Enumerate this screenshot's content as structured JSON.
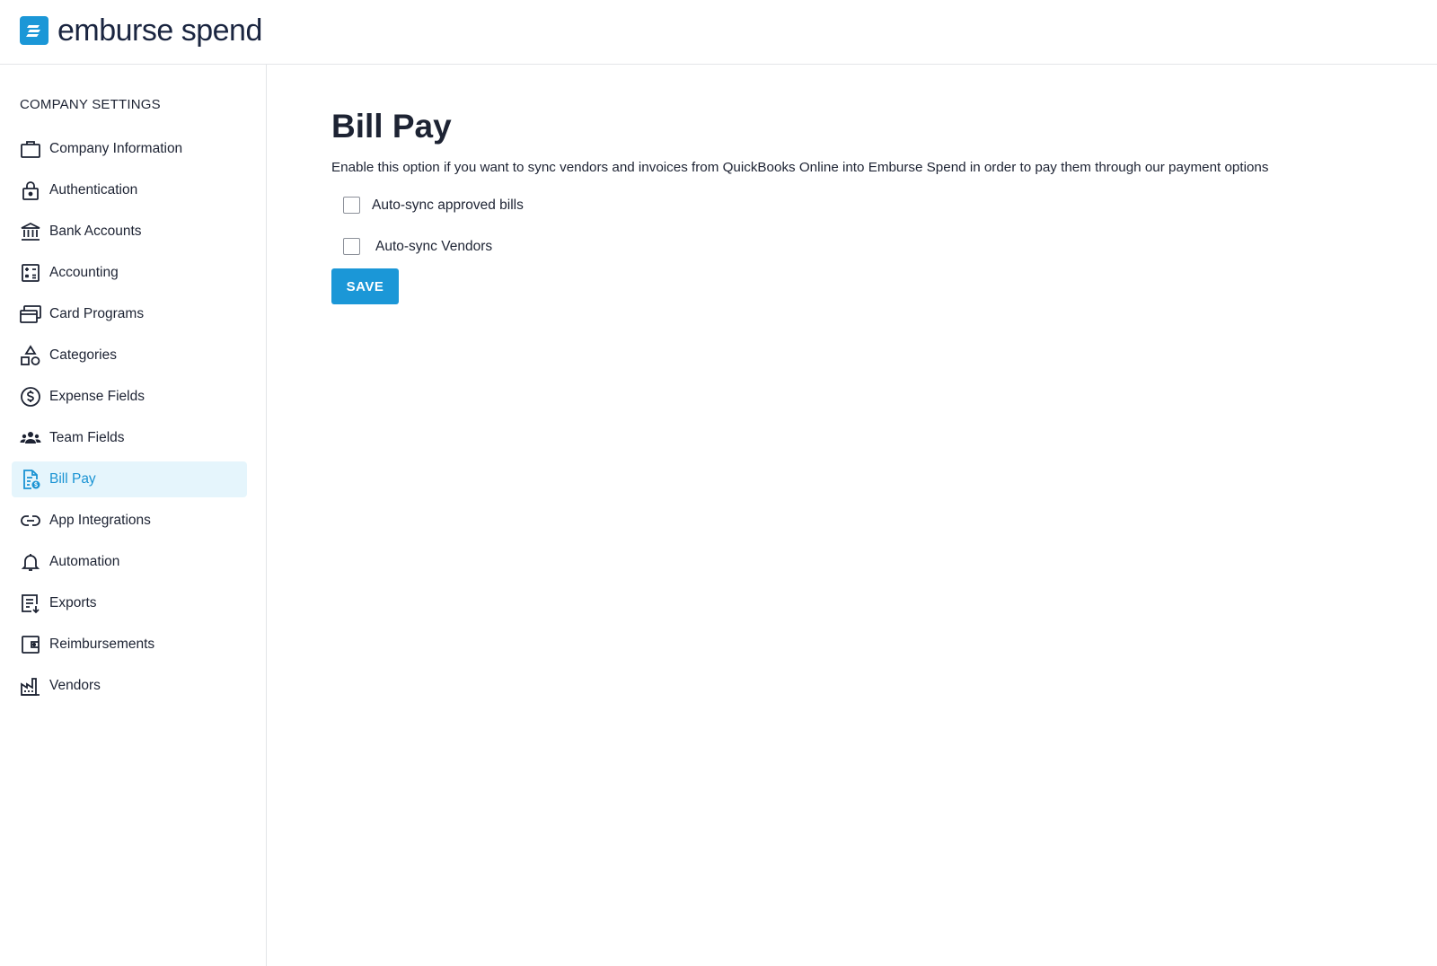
{
  "brand": {
    "name_part1": "emburse",
    "name_part2": "spend",
    "color": "#1b97d7"
  },
  "sidebar": {
    "heading": "COMPANY SETTINGS",
    "items": [
      {
        "label": "Company Information",
        "icon": "briefcase-icon"
      },
      {
        "label": "Authentication",
        "icon": "lock-icon"
      },
      {
        "label": "Bank Accounts",
        "icon": "bank-icon"
      },
      {
        "label": "Accounting",
        "icon": "calculator-icon"
      },
      {
        "label": "Card Programs",
        "icon": "cards-icon"
      },
      {
        "label": "Categories",
        "icon": "shapes-icon"
      },
      {
        "label": "Expense Fields",
        "icon": "dollar-circle-icon"
      },
      {
        "label": "Team Fields",
        "icon": "team-icon"
      },
      {
        "label": "Bill Pay",
        "icon": "bill-icon",
        "active": true
      },
      {
        "label": "App Integrations",
        "icon": "link-icon"
      },
      {
        "label": "Automation",
        "icon": "bell-icon"
      },
      {
        "label": "Exports",
        "icon": "export-icon"
      },
      {
        "label": "Reimbursements",
        "icon": "wallet-icon"
      },
      {
        "label": "Vendors",
        "icon": "factory-icon"
      }
    ],
    "active_color": "#1a93d3",
    "active_bg": "#e5f5fc"
  },
  "main": {
    "title": "Bill Pay",
    "description": "Enable this option if you want to sync vendors and invoices from QuickBooks Online into Emburse Spend in order to pay them through our payment options",
    "options": [
      {
        "label": "Auto-sync approved bills",
        "checked": false
      },
      {
        "label": "Auto-sync Vendors",
        "checked": false
      }
    ],
    "save_label": "SAVE"
  }
}
